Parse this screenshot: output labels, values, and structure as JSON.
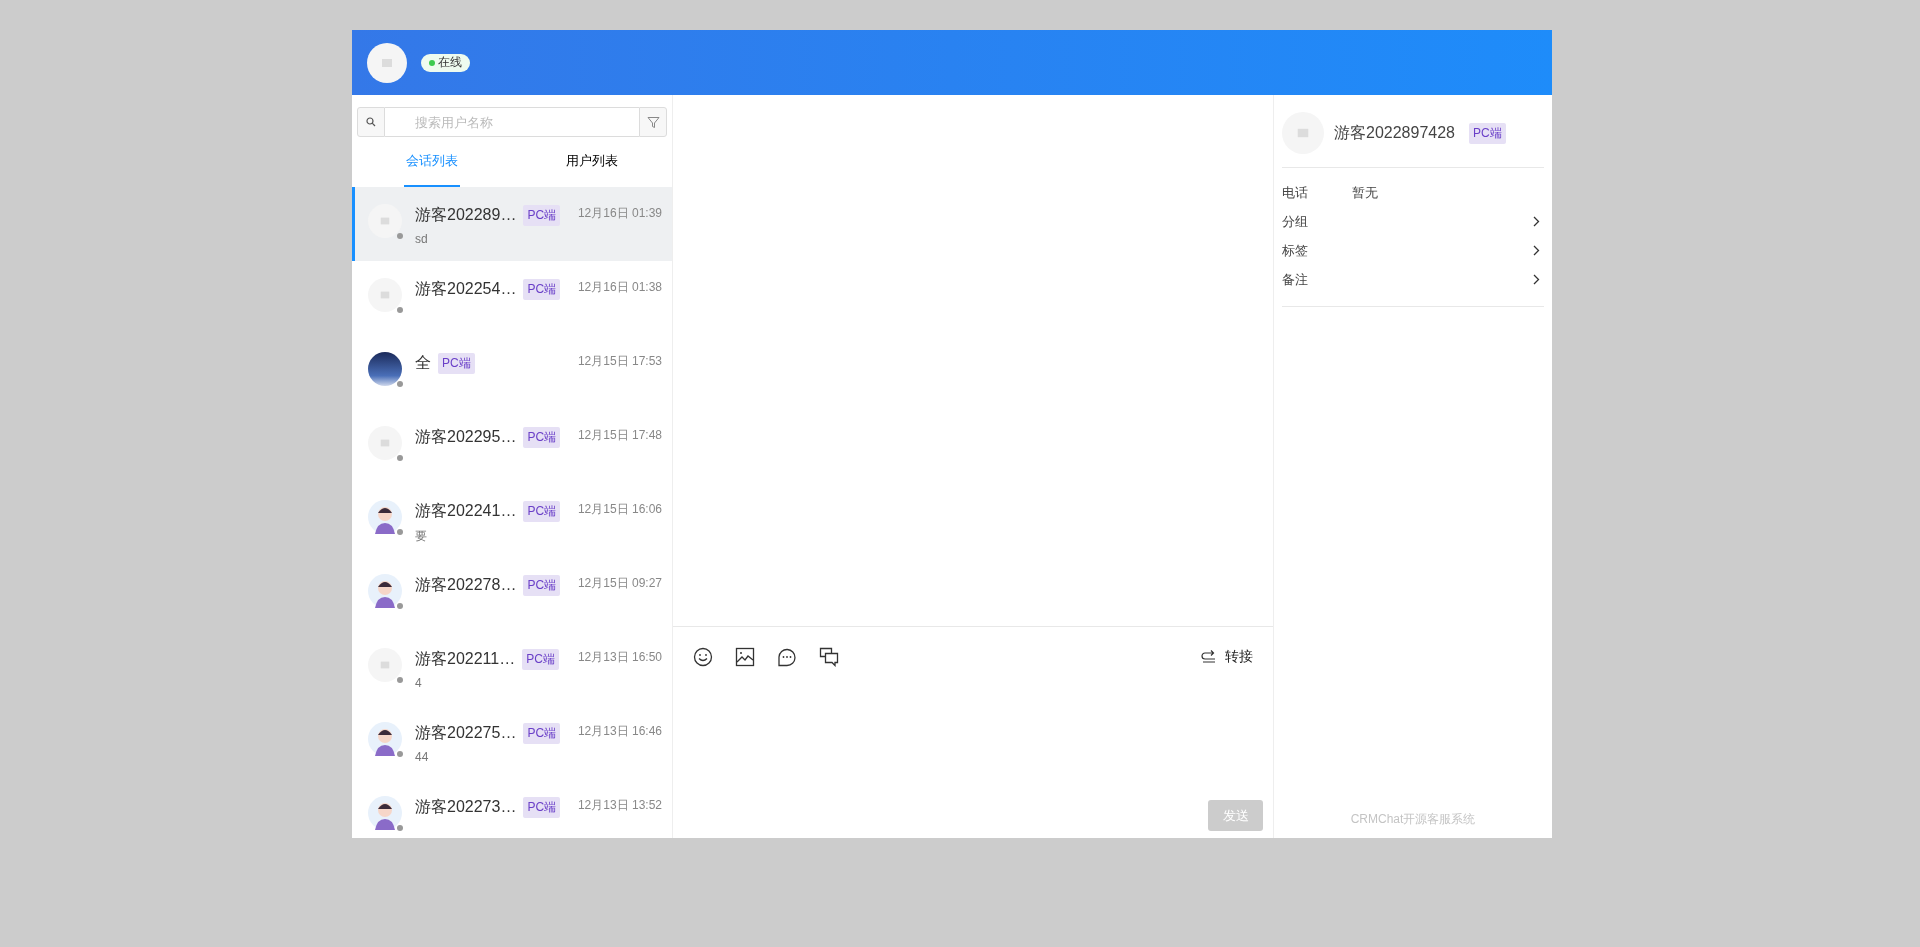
{
  "header": {
    "status": {
      "label": "在线",
      "online": true
    }
  },
  "search": {
    "placeholder": "搜索用户名称"
  },
  "tabs": [
    {
      "label": "会话列表",
      "selected": true
    },
    {
      "label": "用户列表",
      "selected": false
    }
  ],
  "conversations": [
    {
      "name": "游客202289…",
      "tag": "PC端",
      "time": "12月16日 01:39",
      "preview": "sd",
      "avatar": {
        "kind": "placeholder"
      },
      "online": false,
      "selected": true
    },
    {
      "name": "游客202254…",
      "tag": "PC端",
      "time": "12月16日 01:38",
      "avatar": {
        "kind": "placeholder"
      },
      "online": false,
      "selected": false
    },
    {
      "name": "全",
      "tag": "PC端",
      "time": "12月15日 17:53",
      "avatar": {
        "kind": "photo"
      },
      "online": false,
      "selected": false
    },
    {
      "name": "游客202295…",
      "tag": "PC端",
      "time": "12月15日 17:48",
      "avatar": {
        "kind": "placeholder"
      },
      "online": false,
      "selected": false
    },
    {
      "name": "游客202241…",
      "tag": "PC端",
      "time": "12月15日 16:06",
      "preview": "要",
      "avatar": {
        "kind": "cartoon"
      },
      "online": false,
      "selected": false
    },
    {
      "name": "游客202278…",
      "tag": "PC端",
      "time": "12月15日 09:27",
      "avatar": {
        "kind": "cartoon"
      },
      "online": false,
      "selected": false
    },
    {
      "name": "游客202211…",
      "tag": "PC端",
      "time": "12月13日 16:50",
      "preview": "4",
      "avatar": {
        "kind": "placeholder"
      },
      "online": false,
      "selected": false
    },
    {
      "name": "游客202275…",
      "tag": "PC端",
      "time": "12月13日 16:46",
      "preview": "44",
      "avatar": {
        "kind": "cartoon"
      },
      "online": false,
      "selected": false
    },
    {
      "name": "游客202273…",
      "tag": "PC端",
      "time": "12月13日 13:52",
      "avatar": {
        "kind": "cartoon"
      },
      "online": false,
      "selected": false
    }
  ],
  "toolbar": {
    "transfer": "转接"
  },
  "send_button": {
    "label": "发送",
    "disabled": true
  },
  "profile": {
    "name": "游客2022897428",
    "tag": "PC端",
    "fields": [
      {
        "label": "电话",
        "value": "暂无",
        "kind": "text"
      },
      {
        "label": "分组",
        "kind": "link"
      },
      {
        "label": "标签",
        "kind": "link"
      },
      {
        "label": "备注",
        "kind": "link"
      }
    ]
  },
  "footer": "CRMChat开源客服系统"
}
